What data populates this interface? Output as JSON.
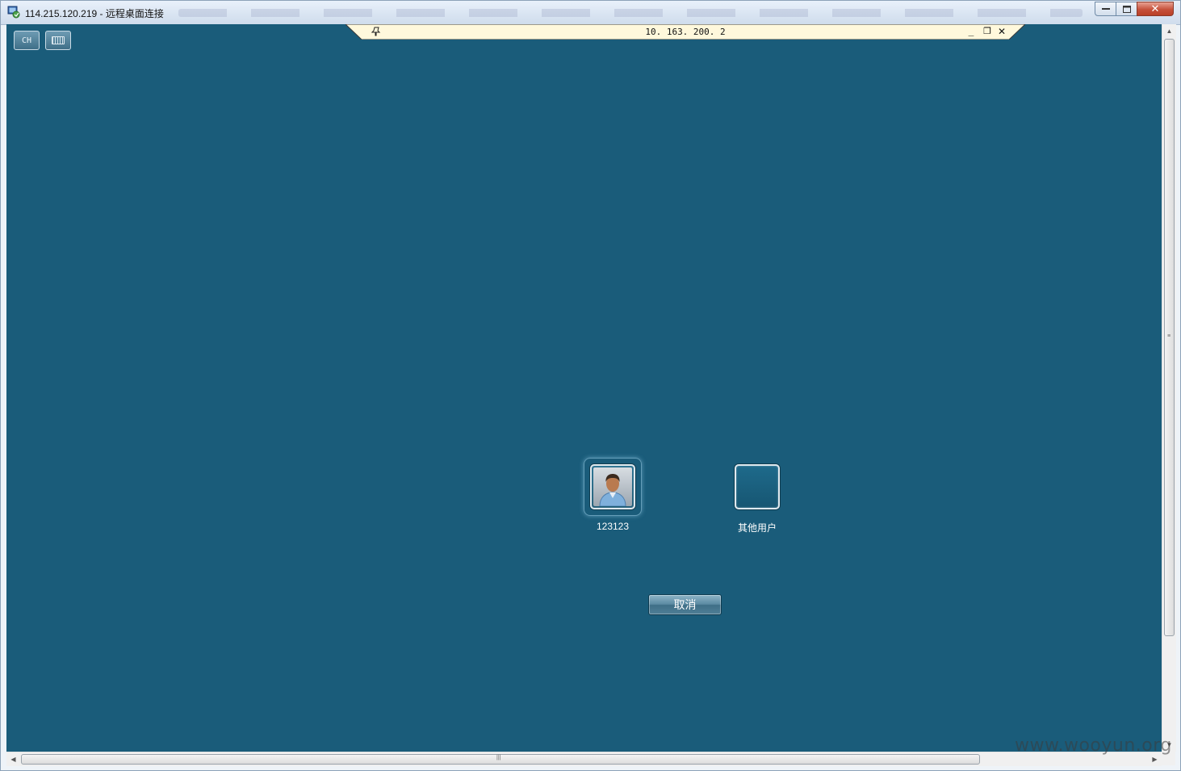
{
  "window": {
    "title": "114.215.120.219 - 远程桌面连接",
    "min_label": "▭",
    "max_label": "▢",
    "close_label": "✕"
  },
  "connection_bar": {
    "host": "10. 163. 200. 2",
    "pin_icon": "pin-icon",
    "min_label": "_",
    "restore_label": "❐",
    "close_label": "✕"
  },
  "toolbar": {
    "lang_label": "CH",
    "keyboard_icon": "keyboard-icon"
  },
  "users": [
    {
      "name": "123123",
      "selected": true,
      "icon": "user-avatar-icon"
    },
    {
      "name": "其他用户",
      "selected": false,
      "icon": "blank-tile"
    }
  ],
  "cancel_label": "取消",
  "colors": {
    "desktop_bg": "#1a5c7a",
    "connbar_bg": "#fff8dc"
  },
  "watermark": "www.wooyun.org"
}
